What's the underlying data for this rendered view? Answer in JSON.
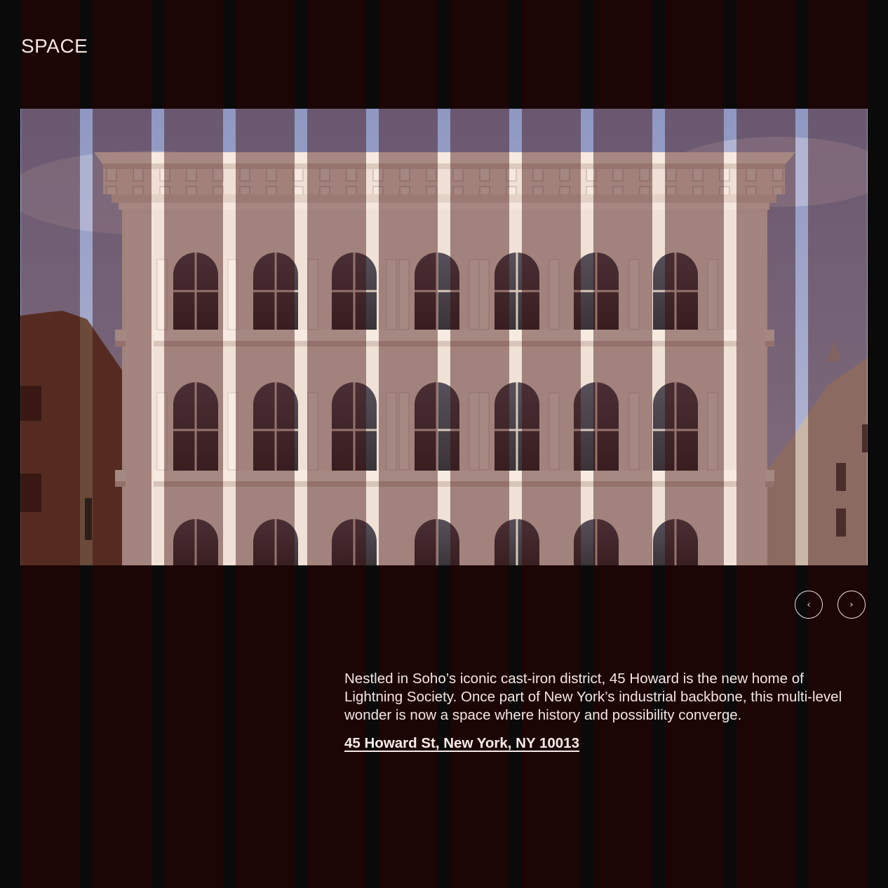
{
  "section": {
    "title": "SPACE"
  },
  "hero": {
    "icon": "building-photo"
  },
  "slider": {
    "prev_icon": "chevron-left-icon",
    "next_icon": "chevron-right-icon",
    "prev_glyph": "‹",
    "next_glyph": "›"
  },
  "content": {
    "description": "Nestled in Soho’s iconic cast-iron district, 45 Howard is the new home of Lightning Society. Once part of New York’s industrial backbone, this multi-level wonder is now a space where history and possibility converge.",
    "address": "45 Howard St, New York, NY 10013"
  },
  "colors": {
    "background": "#0a0a0a",
    "grid_column": "#220808",
    "text": "#f3e6e2",
    "facade": "#f2e2d8",
    "sky": "#9ea7c9"
  }
}
